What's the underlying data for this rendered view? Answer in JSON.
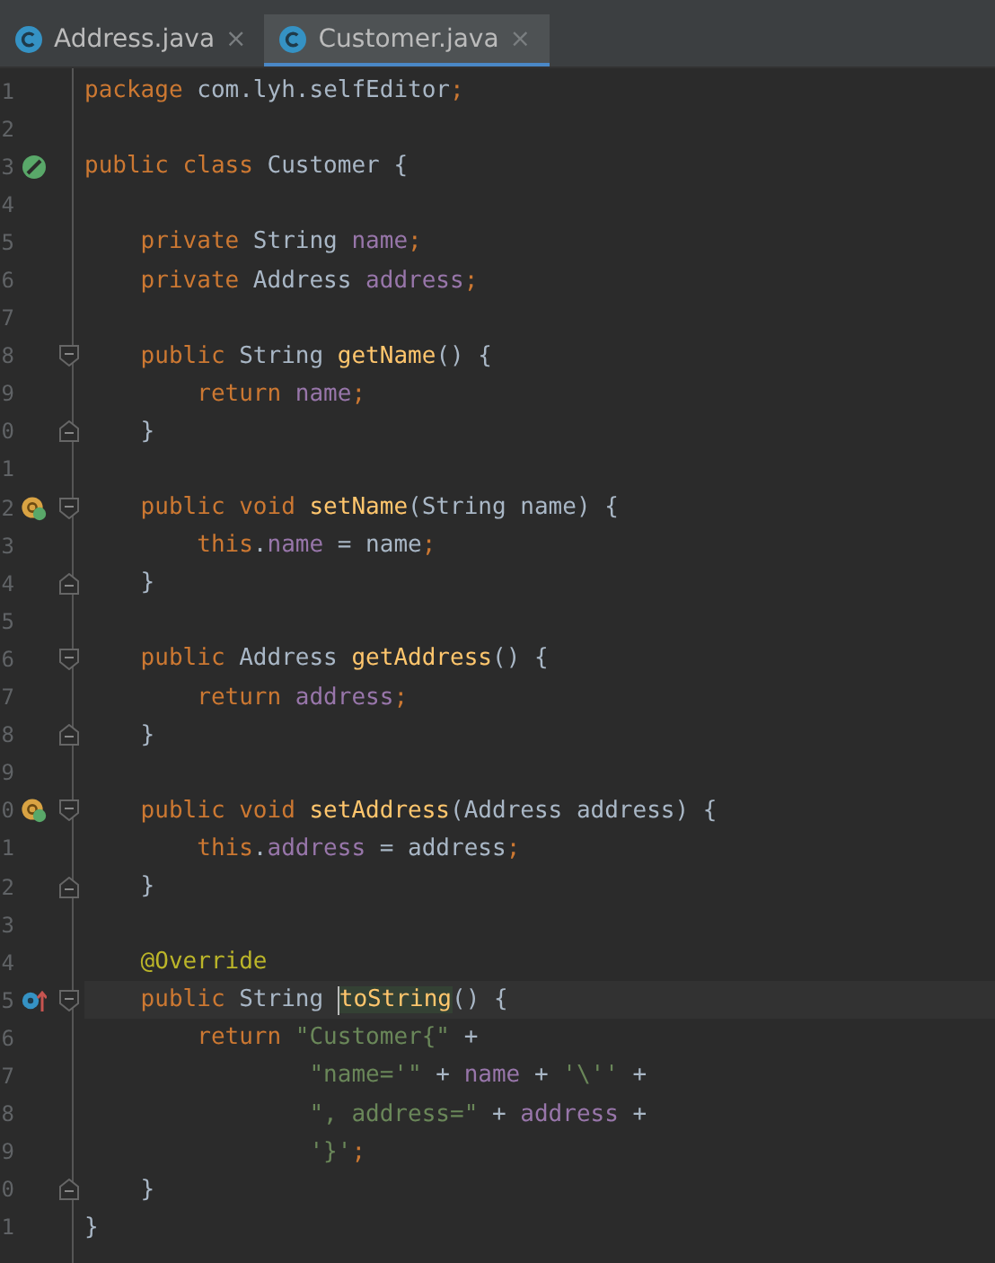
{
  "tabs": [
    {
      "label": "Address.java",
      "close": "×",
      "selected": false
    },
    {
      "label": "Customer.java",
      "close": "×",
      "selected": true
    }
  ],
  "editor": {
    "lines": [
      {
        "number": "1",
        "tokens": [
          {
            "kind": "kw",
            "s": "package "
          },
          {
            "kind": "plain",
            "s": "com.lyh.selfEditor"
          },
          {
            "kind": "kw",
            "s": ";"
          }
        ]
      },
      {
        "number": "2"
      },
      {
        "number": "3",
        "gutter": {
          "kind": "class"
        },
        "tokens": [
          {
            "kind": "kw",
            "s": "public class "
          },
          {
            "kind": "plain",
            "s": "Customer {"
          }
        ]
      },
      {
        "number": "4"
      },
      {
        "number": "5",
        "tokens": [
          {
            "kind": "kw",
            "s": "    private "
          },
          {
            "kind": "plain",
            "s": "String "
          },
          {
            "kind": "field",
            "s": "name"
          },
          {
            "kind": "kw",
            "s": ";"
          }
        ]
      },
      {
        "number": "6",
        "tokens": [
          {
            "kind": "kw",
            "s": "    private "
          },
          {
            "kind": "plain",
            "s": "Address "
          },
          {
            "kind": "field",
            "s": "address"
          },
          {
            "kind": "kw",
            "s": ";"
          }
        ]
      },
      {
        "number": "7"
      },
      {
        "number": "8",
        "fold": {
          "kind": "start"
        },
        "tokens": [
          {
            "kind": "kw",
            "s": "    public "
          },
          {
            "kind": "plain",
            "s": "String "
          },
          {
            "kind": "method",
            "s": "getName"
          },
          {
            "kind": "plain",
            "s": "() {"
          }
        ]
      },
      {
        "number": "9",
        "tokens": [
          {
            "kind": "kw",
            "s": "        return "
          },
          {
            "kind": "field",
            "s": "name"
          },
          {
            "kind": "kw",
            "s": ";"
          }
        ]
      },
      {
        "number": "0",
        "fold": {
          "kind": "end"
        },
        "tokens": [
          {
            "kind": "plain",
            "s": "    }"
          }
        ]
      },
      {
        "number": "1"
      },
      {
        "number": "2",
        "gutter": {
          "kind": "implementing"
        },
        "fold": {
          "kind": "start"
        },
        "tokens": [
          {
            "kind": "kw",
            "s": "    public void "
          },
          {
            "kind": "method",
            "s": "setName"
          },
          {
            "kind": "plain",
            "s": "(String name) {"
          }
        ]
      },
      {
        "number": "3",
        "tokens": [
          {
            "kind": "kw",
            "s": "        this"
          },
          {
            "kind": "plain",
            "s": "."
          },
          {
            "kind": "field",
            "s": "name"
          },
          {
            "kind": "plain",
            "s": " = name"
          },
          {
            "kind": "kw",
            "s": ";"
          }
        ]
      },
      {
        "number": "4",
        "fold": {
          "kind": "end"
        },
        "tokens": [
          {
            "kind": "plain",
            "s": "    }"
          }
        ]
      },
      {
        "number": "5"
      },
      {
        "number": "6",
        "fold": {
          "kind": "start"
        },
        "tokens": [
          {
            "kind": "kw",
            "s": "    public "
          },
          {
            "kind": "plain",
            "s": "Address "
          },
          {
            "kind": "method",
            "s": "getAddress"
          },
          {
            "kind": "plain",
            "s": "() {"
          }
        ]
      },
      {
        "number": "7",
        "tokens": [
          {
            "kind": "kw",
            "s": "        return "
          },
          {
            "kind": "field",
            "s": "address"
          },
          {
            "kind": "kw",
            "s": ";"
          }
        ]
      },
      {
        "number": "8",
        "fold": {
          "kind": "end"
        },
        "tokens": [
          {
            "kind": "plain",
            "s": "    }"
          }
        ]
      },
      {
        "number": "9"
      },
      {
        "number": "0",
        "gutter": {
          "kind": "implementing"
        },
        "fold": {
          "kind": "start"
        },
        "tokens": [
          {
            "kind": "kw",
            "s": "    public void "
          },
          {
            "kind": "method",
            "s": "setAddress"
          },
          {
            "kind": "plain",
            "s": "(Address address) {"
          }
        ]
      },
      {
        "number": "1",
        "tokens": [
          {
            "kind": "kw",
            "s": "        this"
          },
          {
            "kind": "plain",
            "s": "."
          },
          {
            "kind": "field",
            "s": "address"
          },
          {
            "kind": "plain",
            "s": " = address"
          },
          {
            "kind": "kw",
            "s": ";"
          }
        ]
      },
      {
        "number": "2",
        "fold": {
          "kind": "end"
        },
        "tokens": [
          {
            "kind": "plain",
            "s": "    }"
          }
        ]
      },
      {
        "number": "3"
      },
      {
        "number": "4",
        "tokens": [
          {
            "kind": "annotation",
            "s": "    @Override"
          }
        ]
      },
      {
        "number": "5",
        "gutter": {
          "kind": "overriding"
        },
        "fold": {
          "kind": "start"
        },
        "current": true,
        "tokens": [
          {
            "kind": "kw",
            "s": "    public "
          },
          {
            "kind": "plain",
            "s": "String "
          },
          {
            "kind": "caret"
          },
          {
            "kind": "method-hl",
            "s": "toString"
          },
          {
            "kind": "plain",
            "s": "() {"
          }
        ]
      },
      {
        "number": "6",
        "tokens": [
          {
            "kind": "kw",
            "s": "        return "
          },
          {
            "kind": "string",
            "s": "\"Customer{\""
          },
          {
            "kind": "plain",
            "s": " +"
          }
        ]
      },
      {
        "number": "7",
        "tokens": [
          {
            "kind": "string",
            "s": "                \"name='\""
          },
          {
            "kind": "plain",
            "s": " + "
          },
          {
            "kind": "field",
            "s": "name"
          },
          {
            "kind": "plain",
            "s": " + "
          },
          {
            "kind": "string",
            "s": "'\\''"
          },
          {
            "kind": "plain",
            "s": " +"
          }
        ]
      },
      {
        "number": "8",
        "tokens": [
          {
            "kind": "string",
            "s": "                \", address=\""
          },
          {
            "kind": "plain",
            "s": " + "
          },
          {
            "kind": "field",
            "s": "address"
          },
          {
            "kind": "plain",
            "s": " +"
          }
        ]
      },
      {
        "number": "9",
        "tokens": [
          {
            "kind": "string",
            "s": "                '}'"
          },
          {
            "kind": "kw",
            "s": ";"
          }
        ]
      },
      {
        "number": "0",
        "fold": {
          "kind": "end"
        },
        "tokens": [
          {
            "kind": "plain",
            "s": "    }"
          }
        ]
      },
      {
        "number": "1",
        "tokens": [
          {
            "kind": "plain",
            "s": "}"
          }
        ]
      }
    ]
  }
}
